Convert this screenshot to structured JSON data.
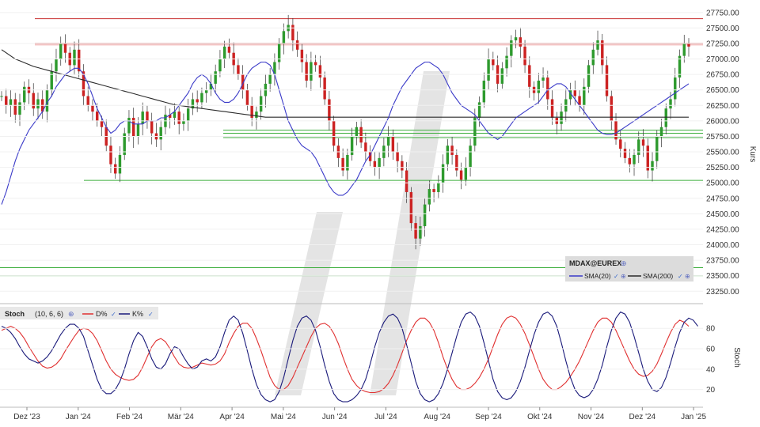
{
  "chart_data": [
    {
      "type": "candlestick",
      "instrument": "MDAX@EUREX",
      "ylabel": "Kurs",
      "ylim": [
        23100,
        27850
      ],
      "y_ticks": [
        23250,
        23500,
        23750,
        24000,
        24250,
        24500,
        24750,
        25000,
        25250,
        25500,
        25750,
        26000,
        26250,
        26500,
        26750,
        27000,
        27250,
        27500,
        27750
      ],
      "y_tick_labels": [
        "23250.00",
        "23500.00",
        "23750.00",
        "24000.00",
        "24250.00",
        "24500.00",
        "24750.00",
        "25000.00",
        "25250.00",
        "25500.00",
        "25750.00",
        "26000.00",
        "26250.00",
        "26500.00",
        "26750.00",
        "27000.00",
        "27250.00",
        "27500.00",
        "27750.00"
      ],
      "x_tick_labels": [
        "Dez '23",
        "Jan '24",
        "Feb '24",
        "Mär '24",
        "Apr '24",
        "Mai '24",
        "Jun '24",
        "Jul '24",
        "Aug '24",
        "Sep '24",
        "Okt '24",
        "Nov '24",
        "Dez '24",
        "Jan '25"
      ],
      "legend": [
        {
          "label": "SMA(20)",
          "color": "#3a3ac8"
        },
        {
          "label": "SMA(200)",
          "color": "#2a2a2a"
        }
      ],
      "legend_title": "MDAX@EUREX",
      "horizontal_lines": [
        {
          "value": 27650,
          "color": "#c83030"
        },
        {
          "value": 27240,
          "color": "#c83030"
        },
        {
          "value": 25850,
          "color": "#3cae3c"
        },
        {
          "value": 25800,
          "color": "#3cae3c"
        },
        {
          "value": 25730,
          "color": "#3cae3c"
        },
        {
          "value": 25040,
          "color": "#3cae3c"
        },
        {
          "value": 23630,
          "color": "#3cae3c"
        },
        {
          "value": 23500,
          "color": "#3cae3c"
        }
      ],
      "series_close": [
        26400,
        26250,
        26350,
        26100,
        26300,
        26550,
        26450,
        26200,
        26350,
        26150,
        26500,
        26800,
        27000,
        27250,
        27100,
        26900,
        27150,
        26800,
        26400,
        26250,
        26150,
        26000,
        25900,
        25600,
        25300,
        25150,
        25450,
        25800,
        26050,
        25750,
        25950,
        26150,
        26000,
        25800,
        25700,
        25900,
        26100,
        26050,
        26150,
        25950,
        26000,
        26200,
        26350,
        26300,
        26450,
        26500,
        26600,
        26800,
        27000,
        27200,
        27100,
        26900,
        26750,
        26500,
        26250,
        26050,
        26150,
        26400,
        26600,
        26750,
        26950,
        27250,
        27450,
        27550,
        27300,
        27150,
        26950,
        26650,
        26950,
        26900,
        26700,
        26350,
        26000,
        25600,
        25400,
        25200,
        25450,
        25750,
        25900,
        25650,
        25500,
        25350,
        25250,
        25400,
        25600,
        25750,
        25500,
        25350,
        25200,
        24850,
        24350,
        24100,
        24300,
        24650,
        24900,
        24850,
        25000,
        25300,
        25600,
        25450,
        25200,
        25050,
        25250,
        25600,
        26050,
        26300,
        26650,
        27000,
        26900,
        26600,
        26850,
        27050,
        27300,
        27350,
        27200,
        26900,
        26550,
        26450,
        26650,
        26700,
        26350,
        26050,
        25950,
        26150,
        26350,
        26500,
        26400,
        26250,
        26550,
        26900,
        27150,
        27300,
        26900,
        26400,
        26000,
        25700,
        25550,
        25400,
        25300,
        25450,
        25700,
        25600,
        25200,
        25350,
        25750,
        25900,
        26200,
        26350,
        26700,
        27050,
        27250,
        27200
      ],
      "sma20": [
        24650,
        24850,
        25100,
        25350,
        25550,
        25700,
        25850,
        25950,
        26050,
        26150,
        26300,
        26400,
        26550,
        26650,
        26750,
        26800,
        26850,
        26850,
        26750,
        26600,
        26400,
        26200,
        26050,
        25900,
        25800,
        25850,
        25950,
        26000,
        26000,
        25950,
        25950,
        25950,
        26000,
        26000,
        26000,
        26050,
        26050,
        26100,
        26150,
        26250,
        26350,
        26450,
        26600,
        26700,
        26750,
        26700,
        26600,
        26450,
        26350,
        26300,
        26300,
        26350,
        26450,
        26600,
        26750,
        26850,
        26900,
        26950,
        26950,
        26900,
        26750,
        26500,
        26250,
        26000,
        25850,
        25700,
        25600,
        25550,
        25500,
        25400,
        25250,
        25100,
        24950,
        24850,
        24800,
        24800,
        24850,
        24950,
        25050,
        25200,
        25350,
        25450,
        25600,
        25750,
        25900,
        26050,
        26250,
        26400,
        26550,
        26650,
        26750,
        26850,
        26900,
        26950,
        26950,
        26900,
        26850,
        26750,
        26600,
        26450,
        26350,
        26250,
        26200,
        26150,
        26100,
        26000,
        25900,
        25800,
        25750,
        25700,
        25750,
        25850,
        25950,
        26050,
        26100,
        26150,
        26200,
        26250,
        26300,
        26400,
        26500,
        26550,
        26600,
        26600,
        26550,
        26450,
        26350,
        26250,
        26150,
        26050,
        25950,
        25850,
        25800,
        25780,
        25780,
        25800,
        25850,
        25900,
        25950,
        26000,
        26050,
        26100,
        26150,
        26200,
        26250,
        26300,
        26350,
        26400,
        26450,
        26500,
        26550,
        26600
      ],
      "sma200": [
        27150,
        27100,
        27050,
        27000,
        26970,
        26940,
        26910,
        26880,
        26860,
        26840,
        26820,
        26800,
        26780,
        26760,
        26740,
        26720,
        26700,
        26680,
        26660,
        26640,
        26620,
        26600,
        26580,
        26560,
        26540,
        26520,
        26500,
        26480,
        26460,
        26440,
        26420,
        26400,
        26380,
        26360,
        26340,
        26320,
        26300,
        26280,
        26260,
        26250,
        26240,
        26230,
        26220,
        26210,
        26200,
        26190,
        26180,
        26170,
        26160,
        26150,
        26140,
        26130,
        26120,
        26110,
        26100,
        26090,
        26080,
        26070,
        26060,
        26060,
        26060,
        26060,
        26060,
        26060,
        26060,
        26060,
        26060,
        26060,
        26060,
        26060,
        26060,
        26060,
        26060,
        26060,
        26060,
        26060,
        26060,
        26060,
        26060,
        26060,
        26060,
        26060,
        26060,
        26060,
        26060,
        26060,
        26060,
        26060,
        26060,
        26060,
        26060,
        26060,
        26060,
        26060,
        26060,
        26060,
        26060,
        26060,
        26060,
        26060,
        26060,
        26060,
        26060,
        26060,
        26060,
        26060,
        26060,
        26060,
        26060,
        26060,
        26060,
        26060,
        26060,
        26060,
        26060,
        26060,
        26060,
        26060,
        26060,
        26060,
        26060,
        26060,
        26060,
        26060,
        26060,
        26060,
        26060,
        26060,
        26060,
        26060,
        26060,
        26060,
        26060,
        26060,
        26060,
        26060,
        26060,
        26060,
        26060,
        26060,
        26060,
        26060,
        26060,
        26060,
        26060,
        26060,
        26060,
        26060,
        26060,
        26060,
        26060,
        26060
      ]
    },
    {
      "type": "line",
      "indicator_label": "Stoch",
      "indicator_params": "(10, 6, 6)",
      "ylabel": "Stoch",
      "ylim": [
        5,
        98
      ],
      "y_ticks": [
        20,
        40,
        60,
        80
      ],
      "y_tick_labels": [
        "20",
        "40",
        "60",
        "80"
      ],
      "series": [
        {
          "name": "D%",
          "color": "#e03030",
          "values": [
            78,
            80,
            82,
            80,
            76,
            70,
            62,
            55,
            48,
            43,
            41,
            42,
            45,
            50,
            58,
            65,
            72,
            78,
            80,
            79,
            75,
            68,
            58,
            48,
            40,
            35,
            32,
            30,
            29,
            30,
            34,
            42,
            52,
            62,
            68,
            70,
            67,
            60,
            52,
            45,
            42,
            41,
            42,
            44,
            46,
            45,
            44,
            45,
            48,
            55,
            66,
            75,
            82,
            85,
            85,
            80,
            70,
            58,
            45,
            32,
            24,
            20,
            20,
            24,
            32,
            42,
            52,
            62,
            72,
            80,
            84,
            85,
            82,
            75,
            65,
            52,
            40,
            30,
            24,
            20,
            18,
            17,
            17,
            18,
            21,
            26,
            34,
            44,
            56,
            68,
            78,
            86,
            90,
            90,
            86,
            78,
            66,
            52,
            40,
            30,
            23,
            20,
            20,
            22,
            26,
            32,
            40,
            50,
            62,
            74,
            84,
            90,
            92,
            90,
            84,
            75,
            64,
            52,
            40,
            30,
            24,
            20,
            20,
            23,
            27,
            33,
            40,
            48,
            58,
            68,
            78,
            86,
            90,
            90,
            86,
            78,
            68,
            58,
            48,
            40,
            35,
            33,
            34,
            38,
            45,
            55,
            66,
            76,
            84,
            88,
            86,
            82
          ]
        },
        {
          "name": "K%",
          "color": "#1a1a7a",
          "values": [
            82,
            80,
            76,
            70,
            62,
            55,
            50,
            48,
            46,
            48,
            52,
            58,
            66,
            74,
            80,
            84,
            84,
            80,
            72,
            58,
            44,
            30,
            20,
            16,
            16,
            20,
            28,
            40,
            55,
            68,
            76,
            72,
            62,
            50,
            42,
            40,
            45,
            55,
            62,
            60,
            52,
            45,
            40,
            42,
            48,
            50,
            48,
            52,
            62,
            76,
            88,
            92,
            88,
            75,
            58,
            40,
            25,
            15,
            10,
            8,
            10,
            18,
            32,
            50,
            68,
            82,
            90,
            92,
            88,
            78,
            62,
            44,
            28,
            16,
            10,
            8,
            8,
            10,
            14,
            20,
            30,
            45,
            62,
            76,
            86,
            92,
            94,
            90,
            80,
            64,
            46,
            28,
            16,
            10,
            8,
            10,
            16,
            26,
            40,
            56,
            72,
            86,
            94,
            96,
            92,
            82,
            66,
            48,
            30,
            18,
            12,
            10,
            12,
            18,
            28,
            42,
            58,
            74,
            86,
            94,
            96,
            92,
            82,
            66,
            48,
            32,
            20,
            14,
            12,
            14,
            20,
            30,
            44,
            62,
            78,
            90,
            96,
            94,
            86,
            72,
            56,
            40,
            28,
            20,
            18,
            22,
            32,
            46,
            62,
            76,
            86,
            90,
            88,
            82
          ]
        }
      ],
      "x_tick_labels": [
        "Dez '23",
        "Jan '24",
        "Feb '24",
        "Mär '24",
        "Apr '24",
        "Mai '24",
        "Jun '24",
        "Jul '24",
        "Aug '24",
        "Sep '24",
        "Okt '24",
        "Nov '24",
        "Dez '24",
        "Jan '25"
      ]
    }
  ]
}
